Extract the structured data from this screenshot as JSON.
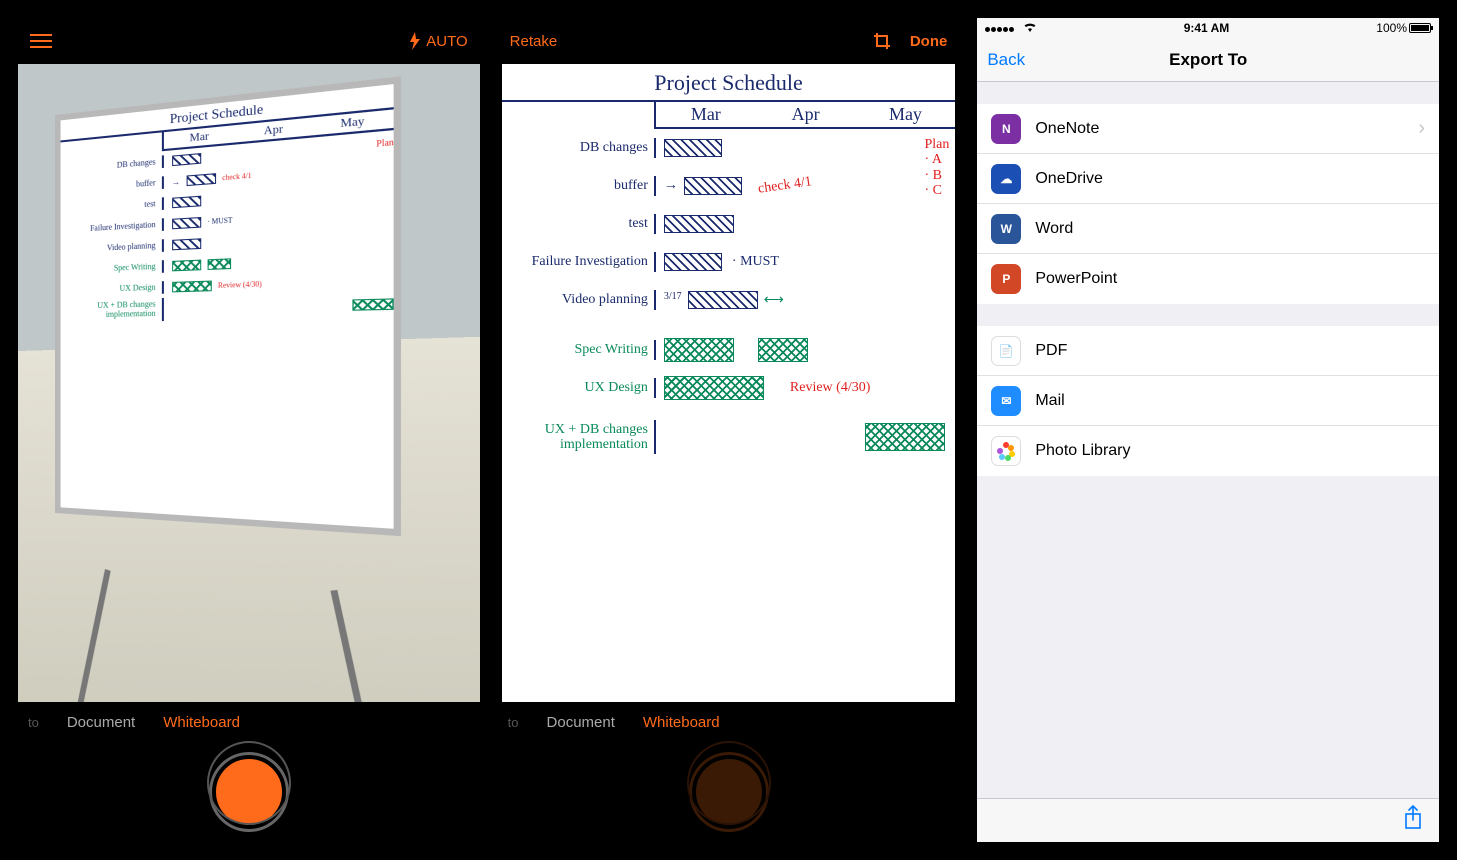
{
  "screen1": {
    "flash_mode": "AUTO",
    "modes": {
      "to": "to",
      "document": "Document",
      "whiteboard": "Whiteboard"
    }
  },
  "screen2": {
    "retake": "Retake",
    "done": "Done",
    "modes": {
      "to": "to",
      "document": "Document",
      "whiteboard": "Whiteboard"
    }
  },
  "whiteboard": {
    "title": "Project   Schedule",
    "months": [
      "Mar",
      "Apr",
      "May"
    ],
    "tasks": {
      "db_changes": "DB changes",
      "buffer": "buffer",
      "test": "test",
      "failure": "Failure Investigation",
      "video": "Video planning",
      "spec": "Spec Writing",
      "ux": "UX Design",
      "uxdb": "UX + DB changes implementation"
    },
    "annotations": {
      "plan": "Plan",
      "plan_a": "· A",
      "plan_b": "· B",
      "plan_c": "· C",
      "check": "check 4/1",
      "must": "· MUST",
      "date317": "3/17",
      "review": "Review (4/30)"
    }
  },
  "screen3": {
    "status": {
      "time": "9:41 AM",
      "battery": "100%"
    },
    "nav": {
      "back": "Back",
      "title": "Export To"
    },
    "group1": [
      {
        "label": "OneNote",
        "icon_bg": "#7b2fa3",
        "icon_txt": "N",
        "chevron": true
      },
      {
        "label": "OneDrive",
        "icon_bg": "#1b4fb3",
        "icon_txt": "☁",
        "chevron": false
      },
      {
        "label": "Word",
        "icon_bg": "#2a5699",
        "icon_txt": "W",
        "chevron": false
      },
      {
        "label": "PowerPoint",
        "icon_bg": "#d24726",
        "icon_txt": "P",
        "chevron": false
      }
    ],
    "group2": [
      {
        "label": "PDF",
        "icon_bg": "#ffffff",
        "icon_txt": "📄",
        "bordered": true
      },
      {
        "label": "Mail",
        "icon_bg": "#1f8dff",
        "icon_txt": "✉"
      },
      {
        "label": "Photo Library",
        "icon_bg": "#ffffff",
        "icon_txt": "❁",
        "bordered": true
      }
    ]
  }
}
